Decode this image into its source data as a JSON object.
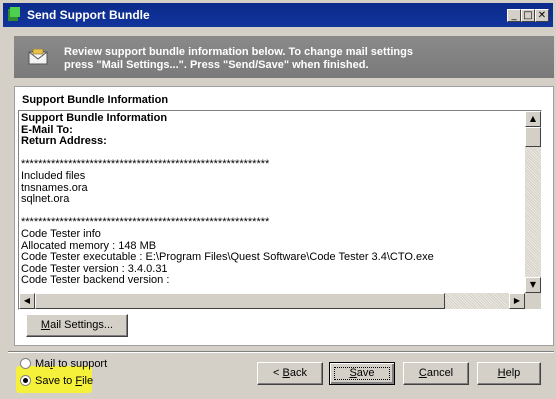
{
  "window": {
    "title": "Send Support Bundle"
  },
  "titlebar_buttons": {
    "minimize": "_",
    "maximize": "□",
    "close": "✕"
  },
  "header": {
    "icon": "mail-icon",
    "line1": "Review support bundle information below. To change mail settings",
    "line2": "press \"Mail Settings...\". Press \"Send/Save\" when finished."
  },
  "panel": {
    "title": "Support Bundle Information"
  },
  "content": {
    "bold_lines": [
      "Support Bundle Information",
      "E-Mail To:",
      "Return Address:"
    ],
    "separator1": "**********************************************************",
    "included_title": "Included files",
    "files": [
      "tnsnames.ora",
      "sqlnet.ora"
    ],
    "separator2": "**********************************************************",
    "info_lines": [
      "Code Tester info",
      "Allocated memory : 148 MB",
      "Code Tester executable : E:\\Program Files\\Quest Software\\Code Tester 3.4\\CTO.exe",
      "Code Tester version : 3.4.0.31",
      "Code Tester backend version :"
    ]
  },
  "buttons": {
    "mail_settings": {
      "pre": "",
      "u": "M",
      "post": "ail Settings..."
    },
    "back": {
      "pre": "< ",
      "u": "B",
      "post": "ack"
    },
    "save": {
      "pre": "",
      "u": "S",
      "post": "ave"
    },
    "cancel": {
      "pre": "",
      "u": "C",
      "post": "ancel"
    },
    "help": {
      "pre": "",
      "u": "H",
      "post": "elp"
    }
  },
  "options": {
    "mail": {
      "pre": "Ma",
      "u": "i",
      "post": "l to support",
      "selected": false
    },
    "save_file": {
      "pre": "Save to ",
      "u": "F",
      "post": "ile",
      "selected": true
    }
  },
  "colors": {
    "titlebar": "#0b2a8a",
    "highlight": "#f5f13a",
    "dialog_bg": "#d4d0c8"
  }
}
